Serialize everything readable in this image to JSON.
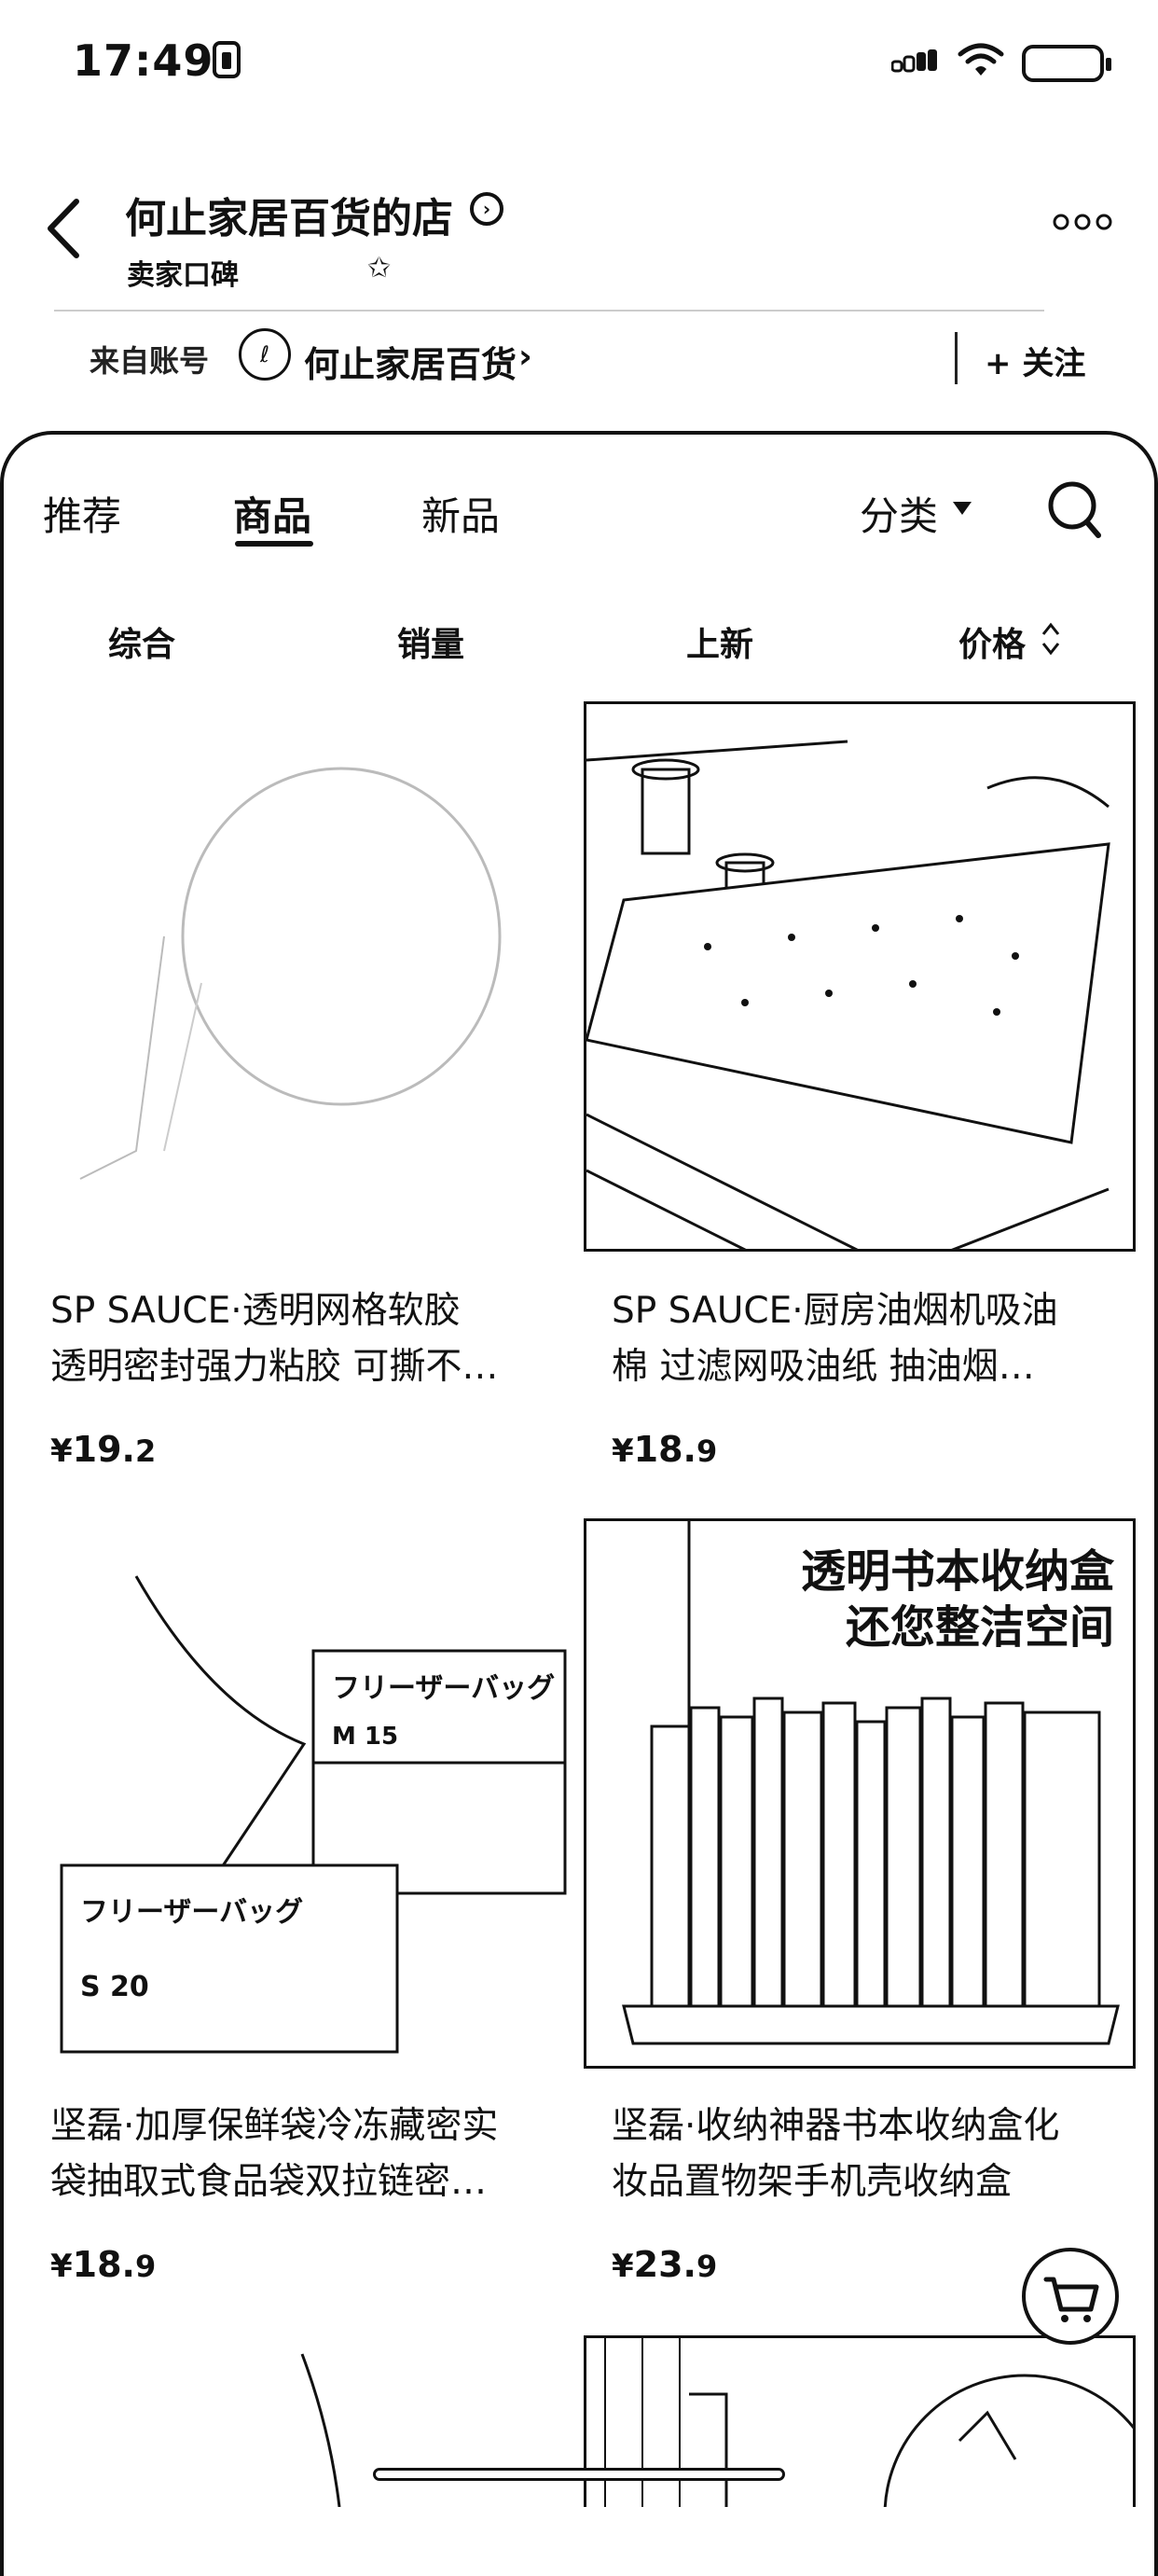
{
  "status_bar": {
    "time": "17:49"
  },
  "header": {
    "store_name": "何止家居百货的店",
    "reputation_label": "卖家口碑",
    "from_account_label": "来自账号",
    "account_name": "何止家居百货",
    "follow_label": "+ 关注"
  },
  "tabs": [
    {
      "label": "推荐"
    },
    {
      "label": "商品"
    },
    {
      "label": "新品"
    }
  ],
  "category_label": "分类",
  "sort_options": [
    {
      "label": "综合"
    },
    {
      "label": "销量"
    },
    {
      "label": "上新"
    },
    {
      "label": "价格"
    }
  ],
  "products": [
    {
      "title_line1": "SP SAUCE·透明网格软胶",
      "title_line2": "透明密封强力粘胶 可撕不…",
      "currency": "¥",
      "price_int": "19.",
      "price_dec": "2"
    },
    {
      "title_line1": "SP SAUCE·厨房油烟机吸油",
      "title_line2": "棉 过滤网吸油纸 抽油烟…",
      "currency": "¥",
      "price_int": "18.",
      "price_dec": "9"
    },
    {
      "title_line1": "坚磊·加厚保鲜袋冷冻藏密实",
      "title_line2": "袋抽取式食品袋双拉链密…",
      "currency": "¥",
      "price_int": "18.",
      "price_dec": "9"
    },
    {
      "title_line1": "坚磊·收纳神器书本收纳盒化",
      "title_line2": "妆品置物架手机壳收纳盒",
      "currency": "¥",
      "price_int": "23.",
      "price_dec": "9"
    }
  ],
  "product_images": {
    "bags_box_brand": "フリーザーバッグ",
    "bags_box_size_m": "M 15",
    "bags_box_size_s": "S 20",
    "organizer_headline_1": "透明书本收纳盒",
    "organizer_headline_2": "还您整洁空间"
  }
}
